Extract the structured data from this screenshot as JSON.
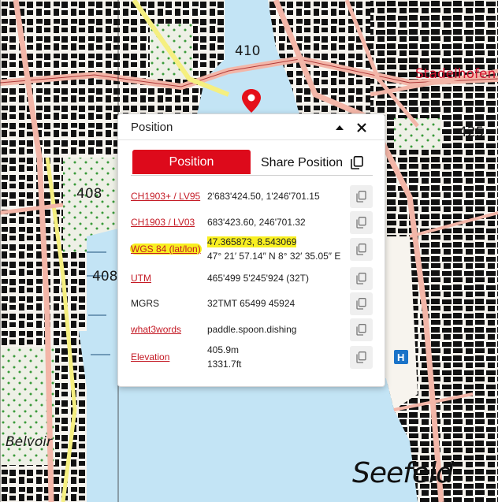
{
  "map": {
    "labels": {
      "elev_408_a": "408",
      "elev_408_b": "408",
      "elev_410": "410",
      "elev_425": "425",
      "stadelhofen": "Stadelhofen",
      "belvoir": "Belvoir",
      "seefeld": "Seefeld"
    },
    "colors": {
      "water": "#c3e4f5",
      "road": "#f3b6a8",
      "highway": "#f5ef80",
      "building": "#0d0d0d",
      "pin": "#e5101a"
    }
  },
  "popup": {
    "title": "Position",
    "tabs": {
      "position": "Position",
      "share": "Share Position"
    },
    "rows": [
      {
        "label": "CH1903+ / LV95",
        "value": "2'683'424.50, 1'246'701.15"
      },
      {
        "label": "CH1903 / LV03",
        "value": "683'423.60, 246'701.32"
      },
      {
        "label": "WGS 84 (lat/lon)",
        "value": "47.365873, 8.543069",
        "value2": "47° 21′ 57.14″ N 8° 32′ 35.05″ E"
      },
      {
        "label": "UTM",
        "value": "465'499 5'245'924 (32T)"
      },
      {
        "label": "MGRS",
        "value": "32TMT 65499 45924"
      },
      {
        "label": "what3words",
        "value": "paddle.spoon.dishing"
      },
      {
        "label": "Elevation",
        "value": "405.9m",
        "value2": "1331.7ft"
      }
    ],
    "accent_color": "#dd0a1b",
    "highlight_color": "#f8ef20"
  }
}
